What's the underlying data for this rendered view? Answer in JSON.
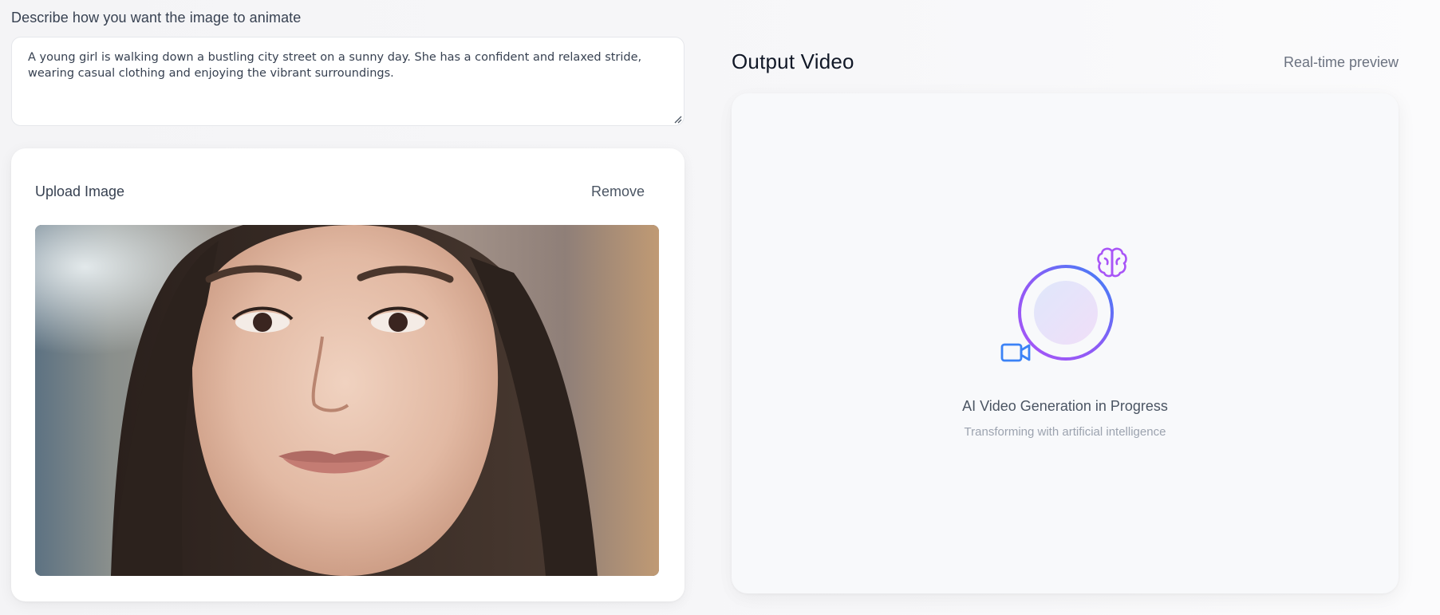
{
  "prompt": {
    "label": "Describe how you want the image to animate",
    "value": "A young girl is walking down a bustling city street on a sunny day. She has a confident and relaxed stride, wearing casual clothing and enjoying the vibrant surroundings."
  },
  "upload": {
    "title": "Upload Image",
    "remove_label": "Remove"
  },
  "output": {
    "title": "Output Video",
    "preview_label": "Real-time preview",
    "status": "AI Video Generation in Progress",
    "substatus": "Transforming with artificial intelligence",
    "icons": [
      "progress-ring-icon",
      "brain-icon",
      "video-camera-icon"
    ]
  },
  "colors": {
    "gradient_blue": "#3b82f6",
    "gradient_purple": "#a855f7",
    "brain": "#a855f7",
    "camera": "#3b82f6"
  }
}
